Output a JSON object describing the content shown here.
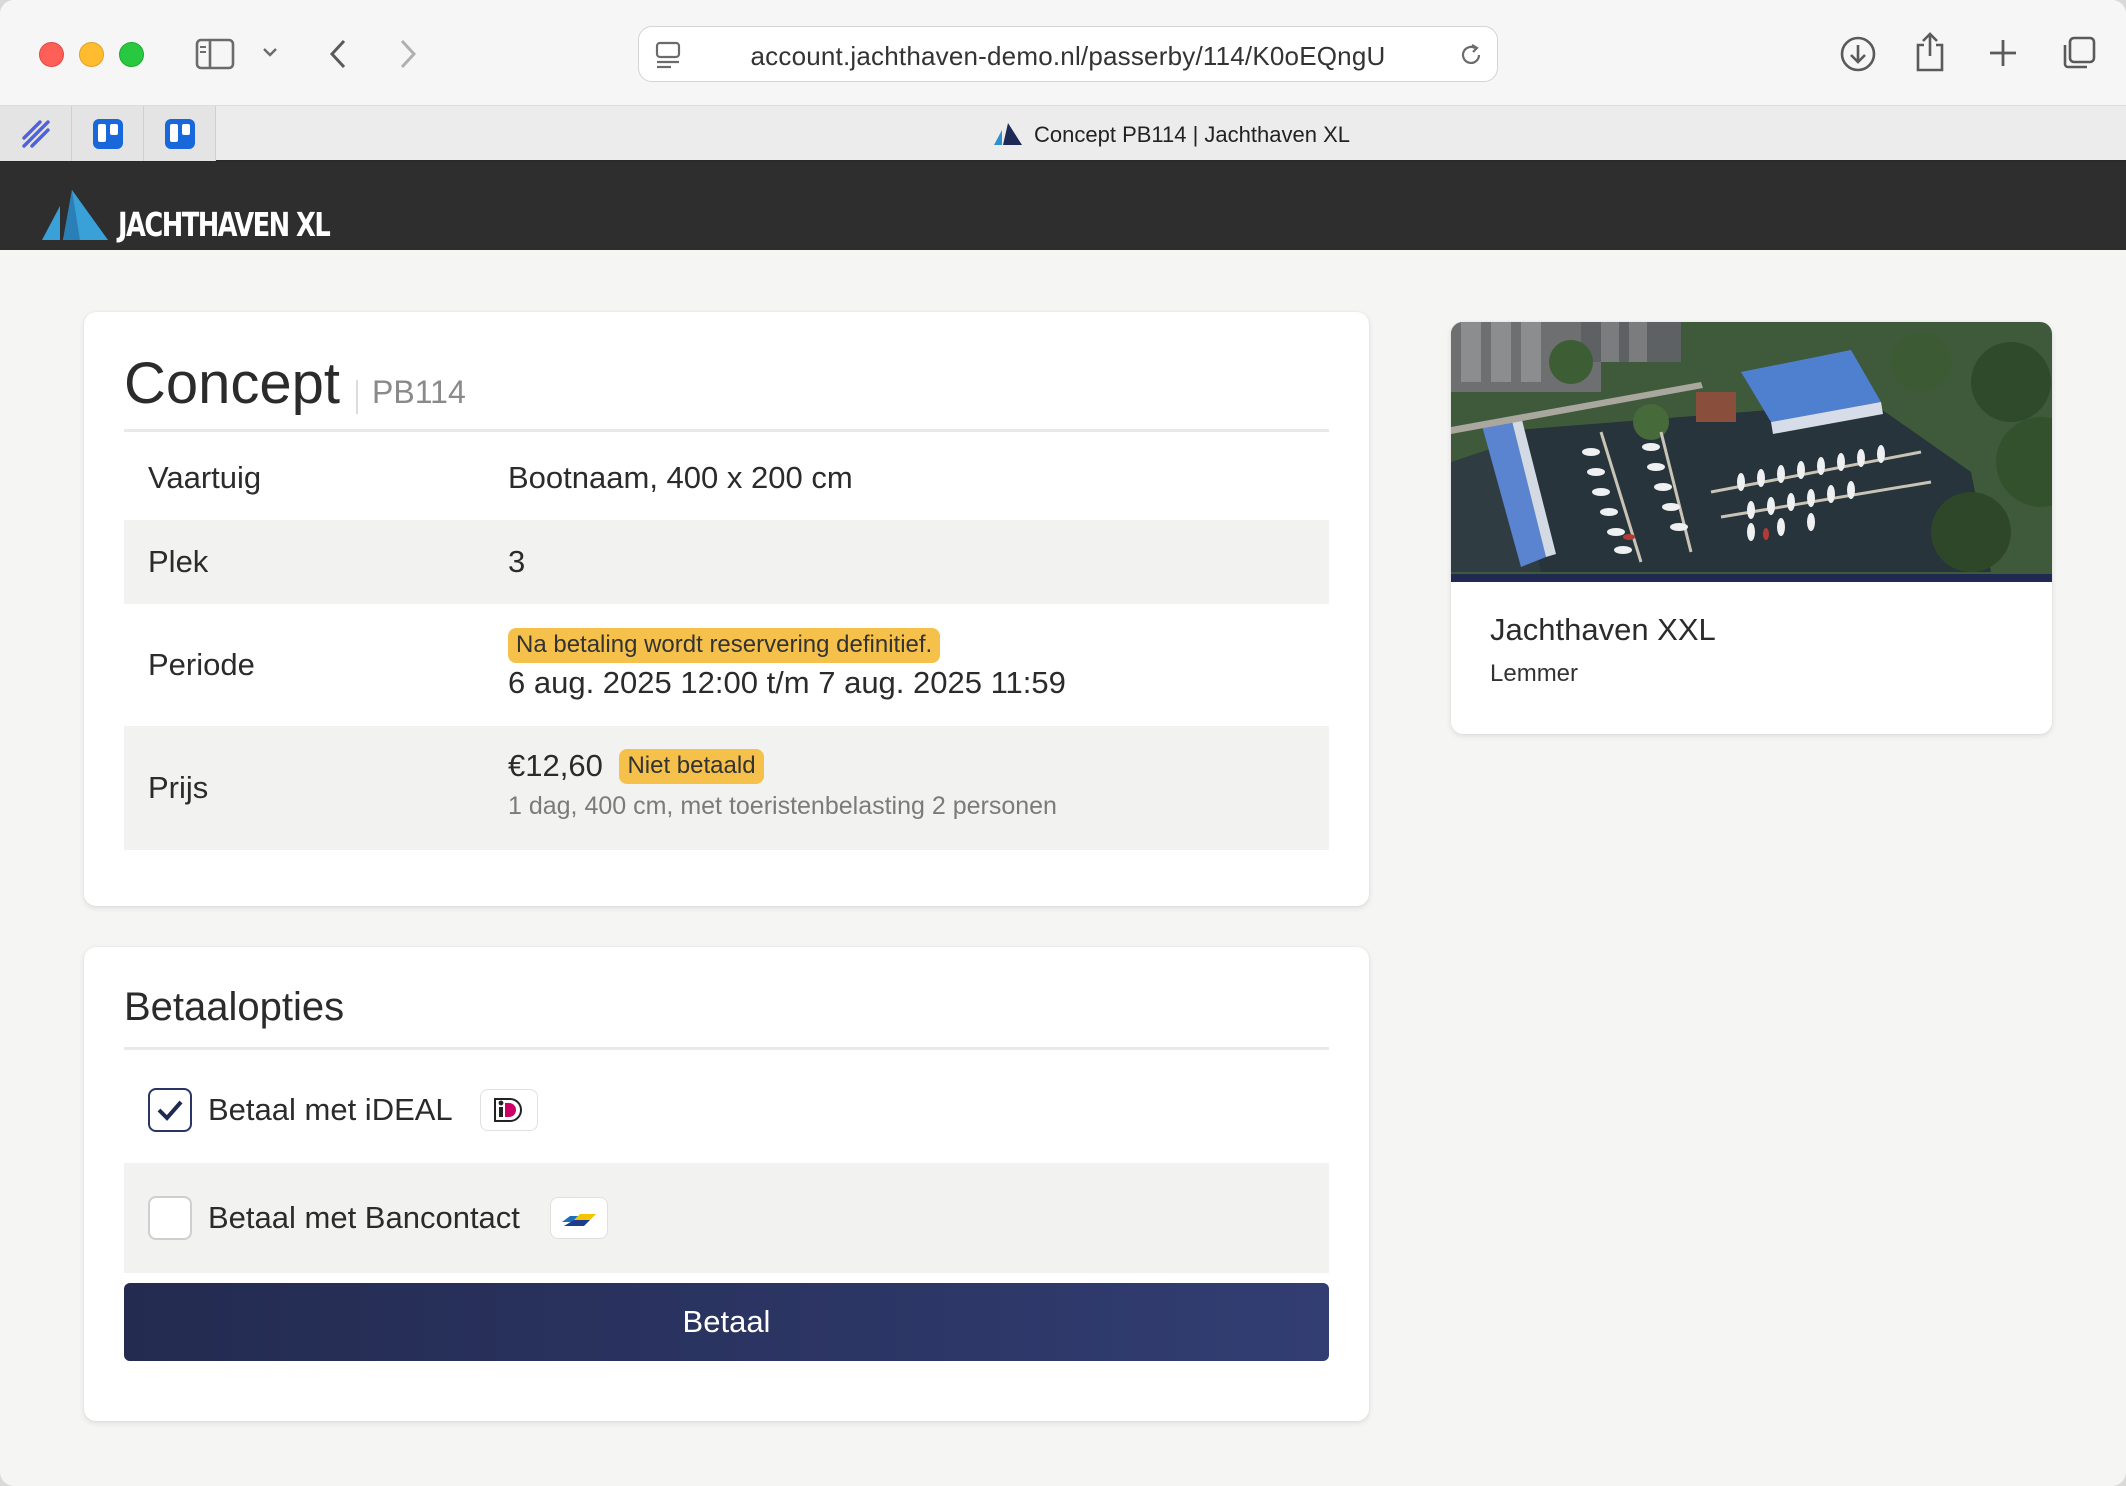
{
  "browser": {
    "url": "account.jachthaven-demo.nl/passerby/114/K0oEQngU",
    "tab_title": "Concept PB114 | Jachthaven XL"
  },
  "site": {
    "brand": "JACHTHAVEN XL"
  },
  "booking": {
    "title": "Concept",
    "code": "PB114",
    "rows": [
      {
        "label": "Vaartuig",
        "value": "Bootnaam, 400 x 200 cm"
      },
      {
        "label": "Plek",
        "value": "3"
      },
      {
        "label": "Periode",
        "badge": "Na betaling wordt reservering definitief.",
        "value": "6 aug. 2025 12:00 t/m 7 aug. 2025 11:59"
      },
      {
        "label": "Prijs",
        "value": "€12,60",
        "badge": "Niet betaald",
        "detail": "1 dag, 400 cm, met toeristenbelasting 2 personen"
      }
    ]
  },
  "payment": {
    "title": "Betaalopties",
    "options": [
      {
        "label": "Betaal met iDEAL",
        "checked": true,
        "icon": "ideal-logo-icon"
      },
      {
        "label": "Betaal met Bancontact",
        "checked": false,
        "icon": "bancontact-logo-icon"
      }
    ],
    "button": "Betaal"
  },
  "harbour": {
    "name": "Jachthaven XXL",
    "location": "Lemmer"
  },
  "colors": {
    "header_bg": "#2e2e2e",
    "badge": "#f6c14a",
    "primary_button": "#2a3566",
    "brand_blue": "#3aa0d8"
  }
}
